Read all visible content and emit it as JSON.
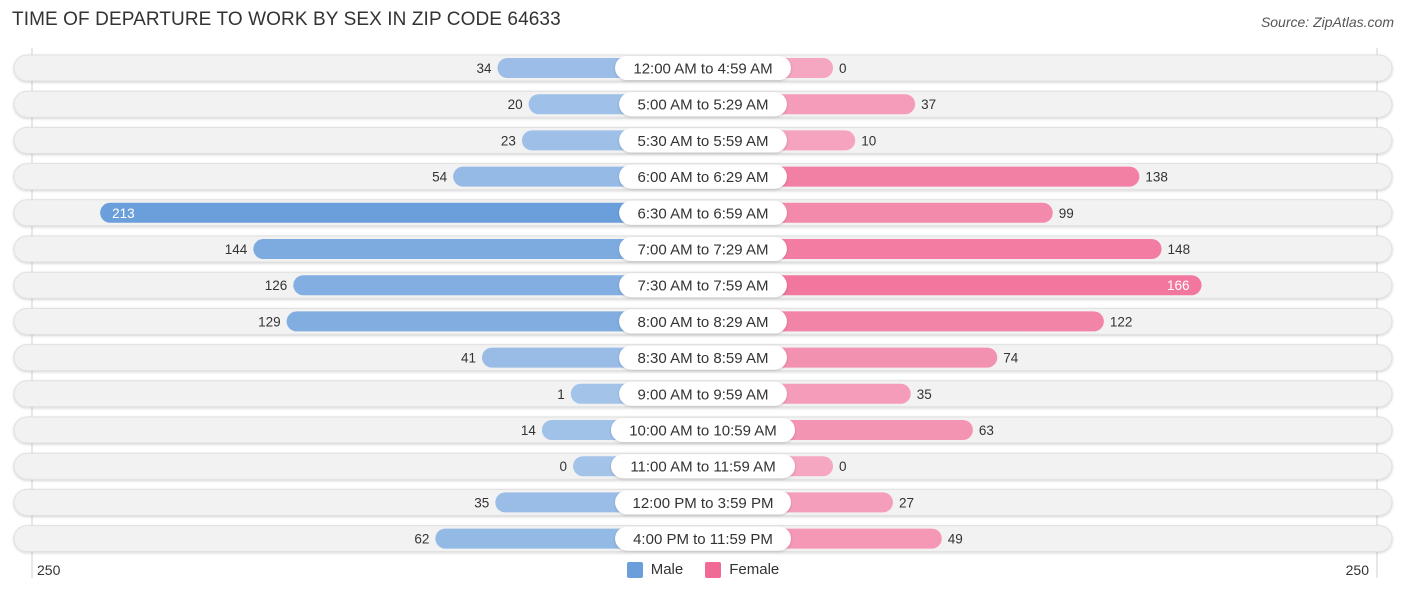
{
  "header": {
    "title": "TIME OF DEPARTURE TO WORK BY SEX IN ZIP CODE 64633",
    "source": "Source: ZipAtlas.com"
  },
  "colors": {
    "male": "#6a9fdc",
    "male_light": "#a4c3e9",
    "female": "#f06a95",
    "female_light": "#f5a6c0",
    "row_bg": "#f2f2f2"
  },
  "chart_data": {
    "type": "bar",
    "orientation": "horizontal-diverging",
    "title": "TIME OF DEPARTURE TO WORK BY SEX IN ZIP CODE 64633",
    "categories": [
      "12:00 AM to 4:59 AM",
      "5:00 AM to 5:29 AM",
      "5:30 AM to 5:59 AM",
      "6:00 AM to 6:29 AM",
      "6:30 AM to 6:59 AM",
      "7:00 AM to 7:29 AM",
      "7:30 AM to 7:59 AM",
      "8:00 AM to 8:29 AM",
      "8:30 AM to 8:59 AM",
      "9:00 AM to 9:59 AM",
      "10:00 AM to 10:59 AM",
      "11:00 AM to 11:59 AM",
      "12:00 PM to 3:59 PM",
      "4:00 PM to 11:59 PM"
    ],
    "series": [
      {
        "name": "Male",
        "values": [
          34,
          20,
          23,
          54,
          213,
          144,
          126,
          129,
          41,
          1,
          14,
          0,
          35,
          62
        ]
      },
      {
        "name": "Female",
        "values": [
          0,
          37,
          10,
          138,
          99,
          148,
          166,
          122,
          74,
          35,
          63,
          0,
          27,
          49
        ]
      }
    ],
    "axis": {
      "left_label": "250",
      "right_label": "250",
      "max": 250
    },
    "legend": {
      "position": "bottom-center",
      "entries": [
        "Male",
        "Female"
      ]
    }
  }
}
